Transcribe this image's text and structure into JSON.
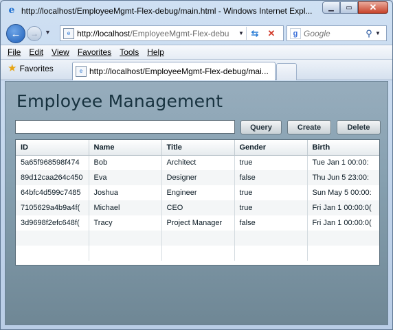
{
  "browser": {
    "window_title": "http://localhost/EmployeeMgmt-Flex-debug/main.html - Windows Internet Expl...",
    "address_host": "http://localhost",
    "address_path": "/EmployeeMgmt-Flex-debu",
    "search_placeholder": "Google",
    "menu": [
      "File",
      "Edit",
      "View",
      "Favorites",
      "Tools",
      "Help"
    ],
    "menu_underline_index": [
      0,
      0,
      0,
      0,
      0,
      0
    ],
    "favorites_label": "Favorites",
    "tab_title": "http://localhost/EmployeeMgmt-Flex-debug/mai..."
  },
  "app": {
    "title": "Employee Management",
    "query_value": "",
    "buttons": {
      "query": "Query",
      "create": "Create",
      "delete": "Delete"
    },
    "columns": [
      "ID",
      "Name",
      "Title",
      "Gender",
      "Birth"
    ],
    "rows": [
      [
        "5a65f968598f474",
        "Bob",
        "Architect",
        "true",
        "Tue Jan 1 00:00:"
      ],
      [
        "89d12caa264c450",
        "Eva",
        "Designer",
        "false",
        "Thu Jun 5 23:00:"
      ],
      [
        "64bfc4d599c7485",
        "Joshua",
        "Engineer",
        "true",
        "Sun May 5 00:00:"
      ],
      [
        "7105629a4b9a4f(",
        "Michael",
        "CEO",
        "true",
        "Fri Jan 1 00:00:0("
      ],
      [
        "3d9698f2efc648f(",
        "Tracy",
        "Project Manager",
        "false",
        "Fri Jan 1 00:00:0("
      ]
    ],
    "empty_rows": 2
  },
  "colors": {
    "content_top": "#97adbd",
    "content_bottom": "#6f8795",
    "title_text": "#17323f",
    "close_button": "#c8432a"
  }
}
